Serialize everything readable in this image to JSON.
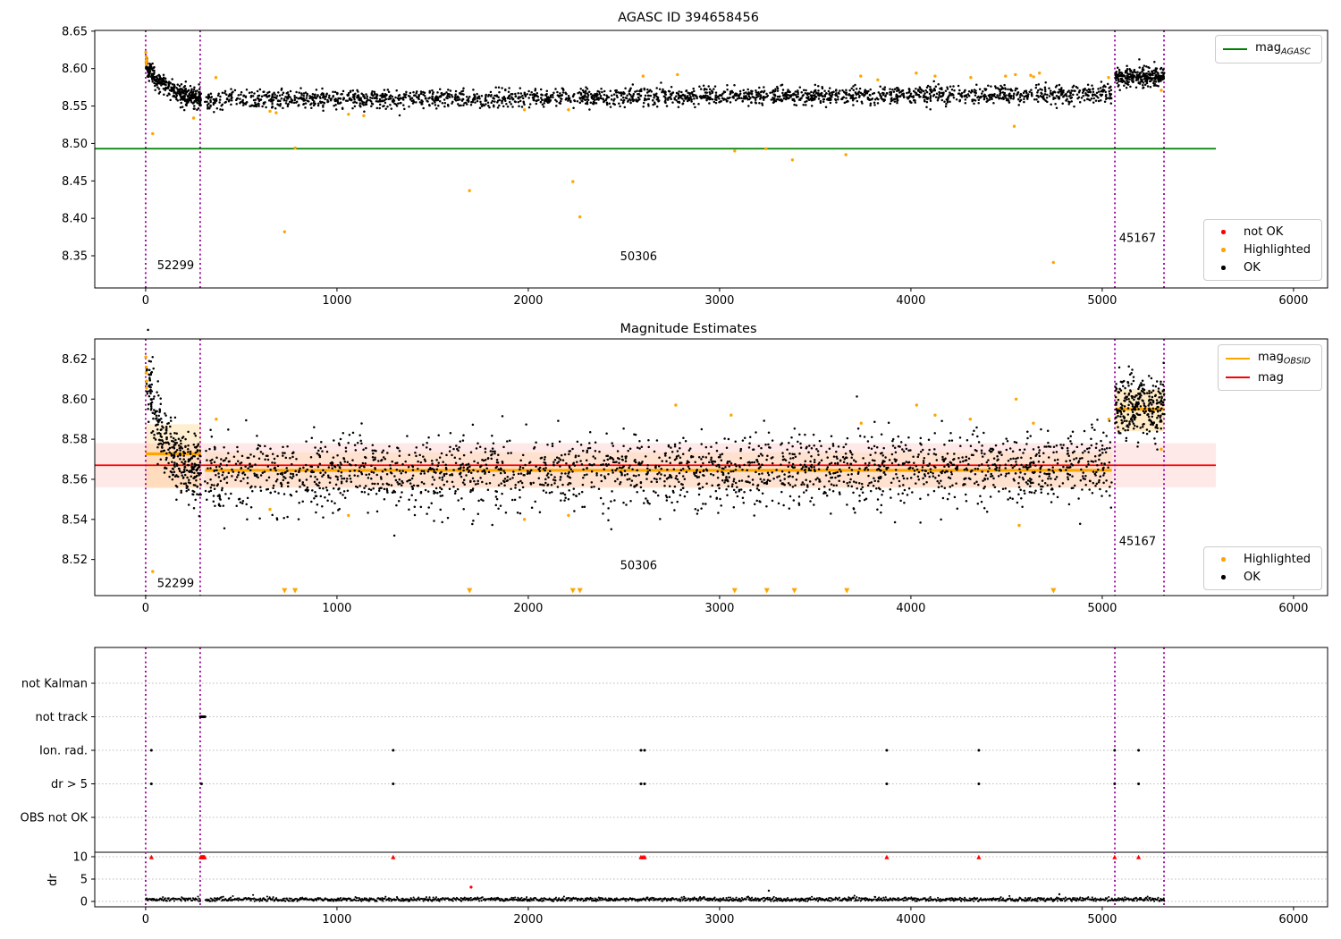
{
  "figure_titles": {
    "top": "AGASC ID 394658456",
    "middle": "Magnitude Estimates"
  },
  "colors": {
    "ok_points": "#000000",
    "highlighted": "#ffa500",
    "not_ok": "#ff0000",
    "mag_agasc_line": "#008000",
    "mag_line": "#ff0000",
    "mag_obsid_line": "#ffa500",
    "obsid_vline": "#980098",
    "grid_dotted": "#bbbbbb",
    "spine": "#000000"
  },
  "legends": [
    {
      "id": "legend-mag-agasc",
      "items": [
        {
          "swatch": "line",
          "color": "#008000",
          "text": "mag",
          "sub": "AGASC"
        }
      ]
    },
    {
      "id": "legend-top-status",
      "items": [
        {
          "swatch": "dot",
          "color": "#ff0000",
          "text": "not OK"
        },
        {
          "swatch": "dot",
          "color": "#ffa500",
          "text": "Highlighted"
        },
        {
          "swatch": "dot",
          "color": "#000000",
          "text": "OK"
        }
      ]
    },
    {
      "id": "legend-mid-lines",
      "items": [
        {
          "swatch": "line",
          "color": "#ffa500",
          "text": "mag",
          "sub": "OBSID"
        },
        {
          "swatch": "line",
          "color": "#ff0000",
          "text": "mag"
        }
      ]
    },
    {
      "id": "legend-mid-status",
      "items": [
        {
          "swatch": "dot",
          "color": "#ffa500",
          "text": "Highlighted"
        },
        {
          "swatch": "dot",
          "color": "#000000",
          "text": "OK"
        }
      ]
    }
  ],
  "chart_data": [
    {
      "id": "agasc-magnitudes",
      "type": "scatter",
      "title": "AGASC ID 394658456",
      "xlabel": "",
      "ylabel": "",
      "xlim": [
        -266,
        6178
      ],
      "ylim": [
        8.307,
        8.651
      ],
      "xticks": [
        0,
        1000,
        2000,
        3000,
        4000,
        5000,
        6000
      ],
      "yticks": [
        8.35,
        8.4,
        8.45,
        8.5,
        8.55,
        8.6,
        8.65
      ],
      "ytick_decimals": 2,
      "grid": false,
      "hlines": [
        {
          "y": 8.493,
          "x0": -266,
          "x1": 5594,
          "color": "#008000",
          "width": 1.8,
          "label": "mag_AGASC"
        }
      ],
      "vlines": [
        0,
        285,
        5066,
        5323
      ],
      "ok_segments": [
        {
          "x0": 2,
          "x1": 290,
          "n": 340,
          "base": 8.5555,
          "amp": 0.05,
          "tau": 115,
          "slope": 0,
          "sigma": 0.0068
        },
        {
          "x0": 310,
          "x1": 5050,
          "n": 2200,
          "base": 8.558,
          "amp": 0,
          "tau": 1,
          "slope": 1.8e-06,
          "sigma": 0.006
        },
        {
          "x0": 5068,
          "x1": 5325,
          "n": 270,
          "base": 8.5895,
          "amp": 0,
          "tau": 1,
          "slope": 0,
          "sigma": 0.0068
        }
      ],
      "highlighted_points": [
        [
          1,
          8.622
        ],
        [
          3,
          8.616
        ],
        [
          5,
          8.612
        ],
        [
          2,
          8.609
        ],
        [
          7,
          8.61
        ],
        [
          4,
          8.606
        ],
        [
          37,
          8.513
        ],
        [
          251,
          8.534
        ],
        [
          367,
          8.588
        ],
        [
          650,
          8.543
        ],
        [
          682,
          8.541
        ],
        [
          726,
          8.382
        ],
        [
          781,
          8.494
        ],
        [
          1060,
          8.539
        ],
        [
          1140,
          8.537
        ],
        [
          1693,
          8.437
        ],
        [
          1980,
          8.545
        ],
        [
          2210,
          8.545
        ],
        [
          2233,
          8.449
        ],
        [
          2270,
          8.402
        ],
        [
          2600,
          8.59
        ],
        [
          2780,
          8.592
        ],
        [
          3079,
          8.49
        ],
        [
          3242,
          8.493
        ],
        [
          3381,
          8.478
        ],
        [
          3660,
          8.485
        ],
        [
          3738,
          8.59
        ],
        [
          3827,
          8.585
        ],
        [
          4028,
          8.594
        ],
        [
          4126,
          8.59
        ],
        [
          4313,
          8.588
        ],
        [
          4495,
          8.59
        ],
        [
          4540,
          8.523
        ],
        [
          4546,
          8.592
        ],
        [
          4626,
          8.591
        ],
        [
          4641,
          8.589
        ],
        [
          4672,
          8.594
        ],
        [
          4745,
          8.341
        ],
        [
          5033,
          8.588
        ],
        [
          5309,
          8.571
        ]
      ],
      "annotations": [
        {
          "text": "52299",
          "x": 60,
          "y": 8.337
        },
        {
          "text": "50306",
          "x": 2480,
          "y": 8.349
        },
        {
          "text": "45167",
          "x": 5088,
          "y": 8.373
        }
      ]
    },
    {
      "id": "magnitude-estimates",
      "type": "scatter",
      "title": "Magnitude Estimates",
      "xlabel": "",
      "ylabel": "",
      "xlim": [
        -266,
        6178
      ],
      "ylim": [
        8.502,
        8.63
      ],
      "xticks": [
        0,
        1000,
        2000,
        3000,
        4000,
        5000,
        6000
      ],
      "yticks": [
        8.52,
        8.54,
        8.56,
        8.58,
        8.6,
        8.62
      ],
      "ytick_decimals": 2,
      "grid": false,
      "bands": [
        {
          "x0": -266,
          "x1": 5594,
          "y0": 8.556,
          "y1": 8.578,
          "color": "#ff0000",
          "opacity": 0.09
        },
        {
          "x0": 0,
          "x1": 290,
          "y0": 8.5555,
          "y1": 8.5875,
          "color": "#ffa500",
          "opacity": 0.18
        },
        {
          "x0": 310,
          "x1": 5050,
          "y0": 8.5555,
          "y1": 8.5735,
          "color": "#ffa500",
          "opacity": 0.1
        },
        {
          "x0": 5068,
          "x1": 5325,
          "y0": 8.584,
          "y1": 8.605,
          "color": "#ffa500",
          "opacity": 0.22
        }
      ],
      "hlines": [
        {
          "y": 8.567,
          "x0": -266,
          "x1": 5594,
          "color": "#ff0000",
          "width": 1.8,
          "label": "mag"
        }
      ],
      "obsid_lines": [
        {
          "x0": 0,
          "x1": 290,
          "y": 8.5727
        },
        {
          "x0": 310,
          "x1": 5050,
          "y": 8.5645
        },
        {
          "x0": 5068,
          "x1": 5325,
          "y": 8.595
        }
      ],
      "vlines": [
        0,
        285,
        5066,
        5323
      ],
      "ok_segments": [
        {
          "x0": 2,
          "x1": 290,
          "n": 330,
          "base": 8.56,
          "amp": 0.055,
          "tau": 100,
          "slope": 0,
          "sigma": 0.0088
        },
        {
          "x0": 310,
          "x1": 5050,
          "n": 2200,
          "base": 8.5625,
          "amp": 0,
          "tau": 1,
          "slope": 7e-07,
          "sigma": 0.0092
        },
        {
          "x0": 5068,
          "x1": 5325,
          "n": 290,
          "base": 8.596,
          "amp": 0,
          "tau": 1,
          "slope": 0,
          "sigma": 0.0078
        }
      ],
      "highlighted_points": [
        [
          1,
          8.621
        ],
        [
          3,
          8.616
        ],
        [
          2,
          8.613
        ],
        [
          5,
          8.609
        ],
        [
          4,
          8.6055
        ],
        [
          37,
          8.514
        ],
        [
          369,
          8.59
        ],
        [
          650,
          8.545
        ],
        [
          1060,
          8.542
        ],
        [
          1980,
          8.54
        ],
        [
          2210,
          8.542
        ],
        [
          2771,
          8.597
        ],
        [
          3060,
          8.592
        ],
        [
          3740,
          8.588
        ],
        [
          4030,
          8.597
        ],
        [
          4126,
          8.592
        ],
        [
          4310,
          8.59
        ],
        [
          4550,
          8.6
        ],
        [
          4566,
          8.537
        ],
        [
          4640,
          8.588
        ],
        [
          5035,
          8.59
        ],
        [
          5309,
          8.575
        ]
      ],
      "clip_low_markers": {
        "y": 8.5045,
        "xs": [
          726,
          781,
          1693,
          2233,
          2270,
          3079,
          3247,
          3391,
          3665,
          4745
        ]
      },
      "annotations": [
        {
          "text": "52299",
          "x": 60,
          "y": 8.508
        },
        {
          "text": "50306",
          "x": 2480,
          "y": 8.517
        },
        {
          "text": "45167",
          "x": 5088,
          "y": 8.529
        }
      ]
    },
    {
      "id": "flags-and-dr",
      "type": "flags",
      "rows": [
        "not Kalman",
        "not track",
        "Ion. rad.",
        "dr > 5",
        "OBS not OK"
      ],
      "ylabel": "dr",
      "dr_ticks": [
        10,
        5,
        0
      ],
      "xlim": [
        -266,
        6178
      ],
      "xticks": [
        0,
        1000,
        2000,
        3000,
        4000,
        5000,
        6000
      ],
      "vlines": [
        0,
        285,
        5066,
        5323
      ],
      "flag_points": [
        {
          "row": "not track",
          "xs": [
            286,
            289,
            292,
            295,
            298,
            301,
            304,
            307,
            310
          ]
        },
        {
          "row": "Ion. rad.",
          "xs": [
            30,
            1294,
            2589,
            2608,
            3874,
            4355,
            5065,
            5190
          ]
        },
        {
          "row": "dr > 5",
          "xs": [
            30,
            292,
            1294,
            2589,
            2608,
            3874,
            4355,
            5065,
            5190
          ]
        }
      ],
      "clipped_red": {
        "dr": 9.9,
        "xs": [
          30,
          288,
          292,
          296,
          300,
          304,
          308,
          1294,
          2589,
          2599,
          2608,
          3874,
          4355,
          5065,
          5190
        ]
      },
      "red_points": [
        [
          1701,
          3.2
        ]
      ],
      "dr_spikes": [
        [
          3257,
          2.4
        ],
        [
          4776,
          1.6
        ]
      ],
      "dr_trace": {
        "x0": 2,
        "x1": 5325,
        "gap": [
          286,
          310
        ],
        "n": 1650,
        "mean": 0.45,
        "sigma": 0.22
      }
    }
  ]
}
